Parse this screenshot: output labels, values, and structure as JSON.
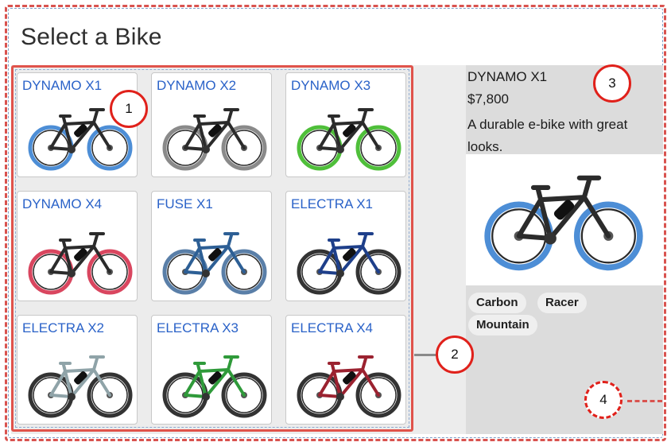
{
  "page": {
    "title": "Select a Bike"
  },
  "bikes": [
    {
      "name": "DYNAMO X1",
      "accent": "#4d8ed6",
      "frame": "#2b2b2b"
    },
    {
      "name": "DYNAMO X2",
      "accent": "#8a8a8a",
      "frame": "#2b2b2b"
    },
    {
      "name": "DYNAMO X3",
      "accent": "#4fbf3a",
      "frame": "#2b2b2b"
    },
    {
      "name": "DYNAMO X4",
      "accent": "#d9465f",
      "frame": "#2b2b2b"
    },
    {
      "name": "FUSE X1",
      "accent": "#5a7fa8",
      "frame": "#2d5f95"
    },
    {
      "name": "ELECTRA X1",
      "accent": "#333333",
      "frame": "#1e3f8a"
    },
    {
      "name": "ELECTRA X2",
      "accent": "#333333",
      "frame": "#8fa3a8"
    },
    {
      "name": "ELECTRA X3",
      "accent": "#333333",
      "frame": "#2f9a3a"
    },
    {
      "name": "ELECTRA X4",
      "accent": "#333333",
      "frame": "#9b2230"
    }
  ],
  "detail": {
    "name": "DYNAMO X1",
    "price": "$7,800",
    "description": "A durable e-bike with great looks.",
    "tags": [
      "Carbon",
      "Racer",
      "Mountain"
    ]
  },
  "callouts": [
    "1",
    "2",
    "3",
    "4"
  ]
}
